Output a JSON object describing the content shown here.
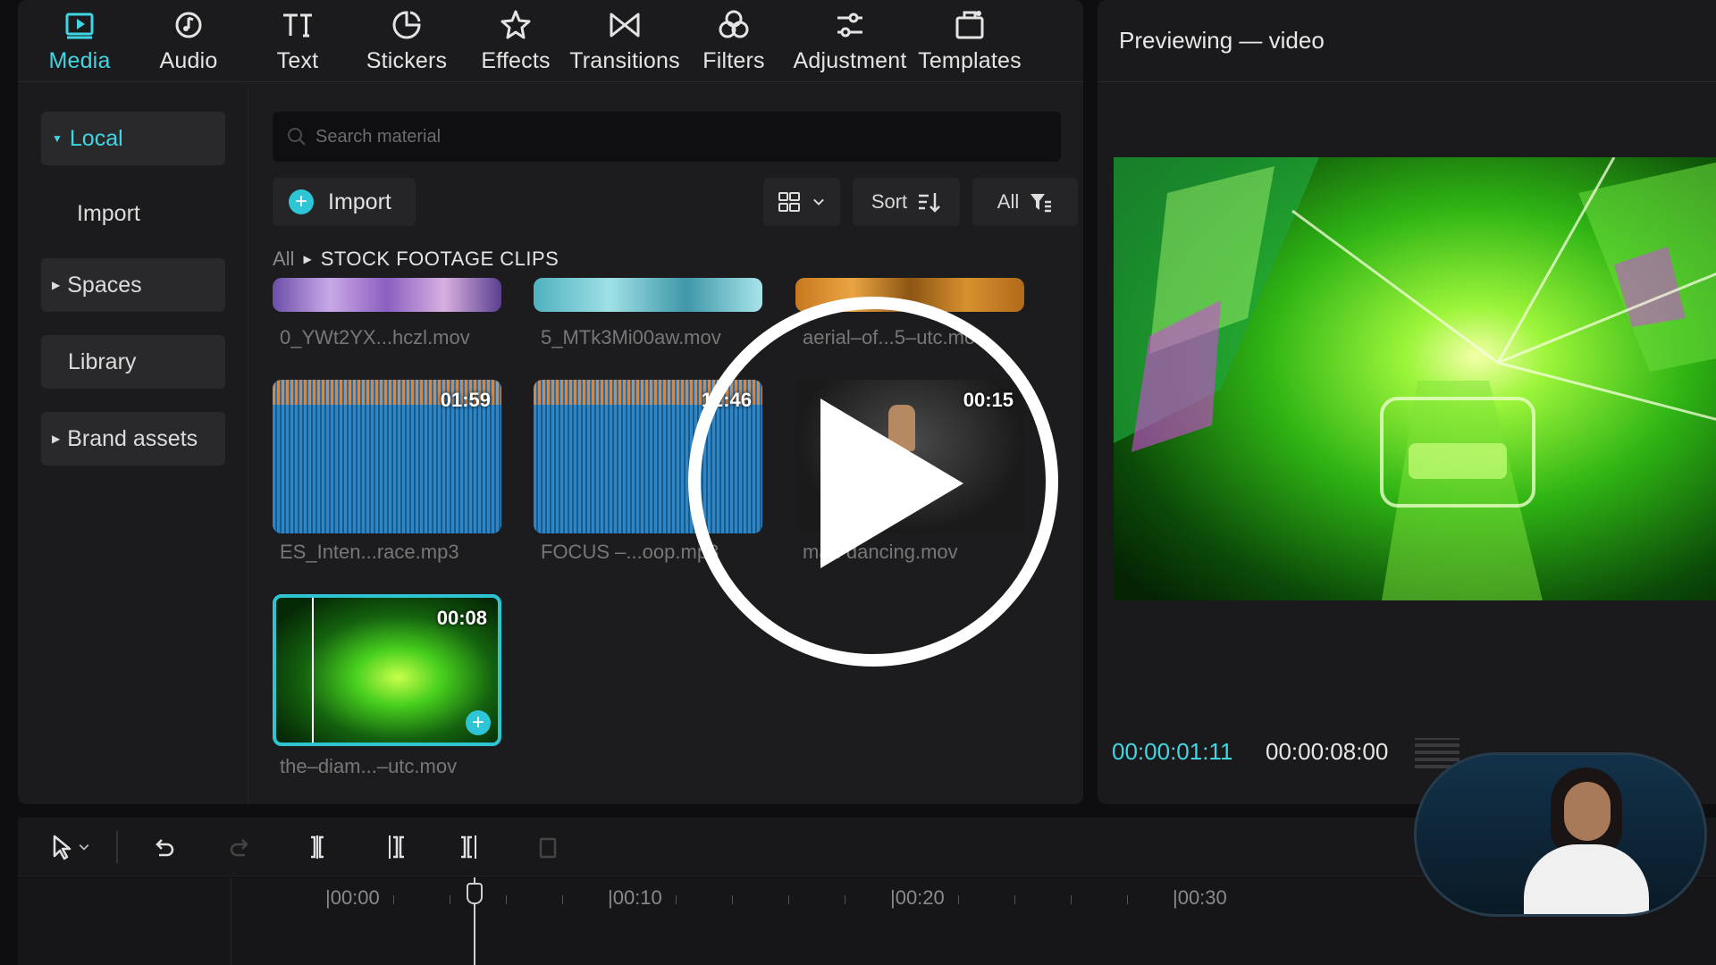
{
  "toolbar": {
    "tools": [
      {
        "label": "Media",
        "icon": "media-icon",
        "active": true
      },
      {
        "label": "Audio",
        "icon": "audio-icon"
      },
      {
        "label": "Text",
        "icon": "text-icon"
      },
      {
        "label": "Stickers",
        "icon": "sticker-icon"
      },
      {
        "label": "Effects",
        "icon": "effects-icon"
      },
      {
        "label": "Transitions",
        "icon": "transitions-icon"
      },
      {
        "label": "Filters",
        "icon": "filters-icon"
      },
      {
        "label": "Adjustment",
        "icon": "adjustment-icon"
      },
      {
        "label": "Templates",
        "icon": "templates-icon"
      }
    ]
  },
  "sidebar": {
    "items": [
      {
        "label": "Local",
        "active": true,
        "expandable": true
      },
      {
        "label": "Import"
      },
      {
        "label": "Spaces",
        "expandable": true
      },
      {
        "label": "Library"
      },
      {
        "label": "Brand assets",
        "expandable": true
      }
    ]
  },
  "media": {
    "search_placeholder": "Search material",
    "import_label": "Import",
    "sort_label": "Sort",
    "filter_label": "All",
    "breadcrumb": {
      "root": "All",
      "current": "STOCK FOOTAGE CLIPS"
    },
    "files": [
      {
        "name": "0_YWt2YX...hczl.mov",
        "duration": ""
      },
      {
        "name": "5_MTk3Mi00aw.mov",
        "duration": ""
      },
      {
        "name": "aerial–of...5–utc.mov",
        "duration": ""
      },
      {
        "name": "ES_Inten...race.mp3",
        "duration": "01:59"
      },
      {
        "name": "FOCUS –...oop.mp3",
        "duration": "12:46"
      },
      {
        "name": "man dancing.mov",
        "duration": "00:15"
      },
      {
        "name": "the–diam...–utc.mov",
        "duration": "00:08"
      }
    ]
  },
  "preview": {
    "title": "Previewing — video",
    "current_time": "00:00:01:11",
    "total_time": "00:00:08:00"
  },
  "timeline": {
    "ticks": [
      "|00:00",
      "|00:10",
      "|00:20",
      "|00:30"
    ]
  },
  "colors": {
    "accent": "#3fd6e4",
    "panel": "#1b1b1d",
    "background": "#0e0e10"
  }
}
